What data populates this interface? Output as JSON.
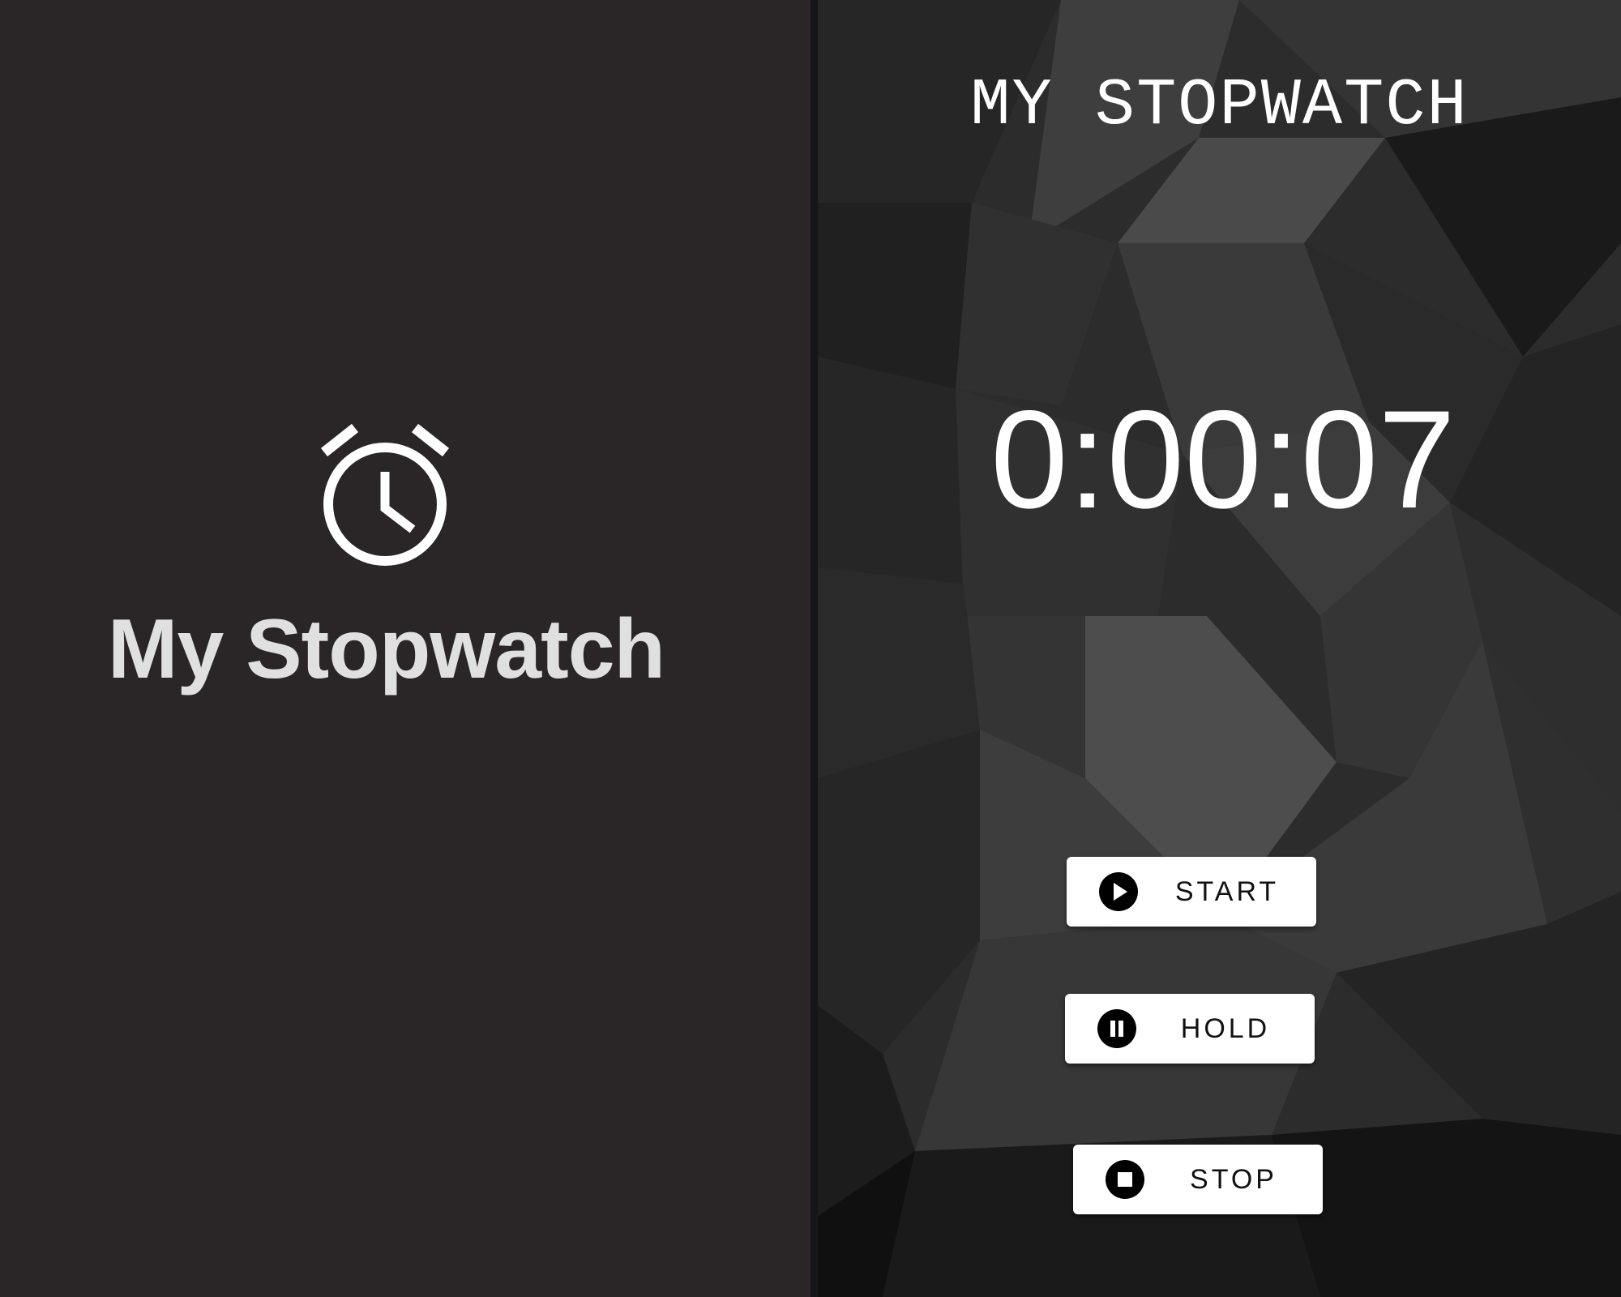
{
  "splash": {
    "icon": "alarm-clock-icon",
    "title": "My Stopwatch",
    "background_color": "#2a2526",
    "title_color": "#e0e0e0"
  },
  "app": {
    "title": "MY STOPWATCH",
    "timer": "0:00:07",
    "background": "low-poly grayscale pattern",
    "buttons": [
      {
        "label": "START",
        "icon": "play-circle-icon"
      },
      {
        "label": "HOLD",
        "icon": "pause-circle-icon"
      },
      {
        "label": "STOP",
        "icon": "stop-circle-icon"
      }
    ]
  }
}
